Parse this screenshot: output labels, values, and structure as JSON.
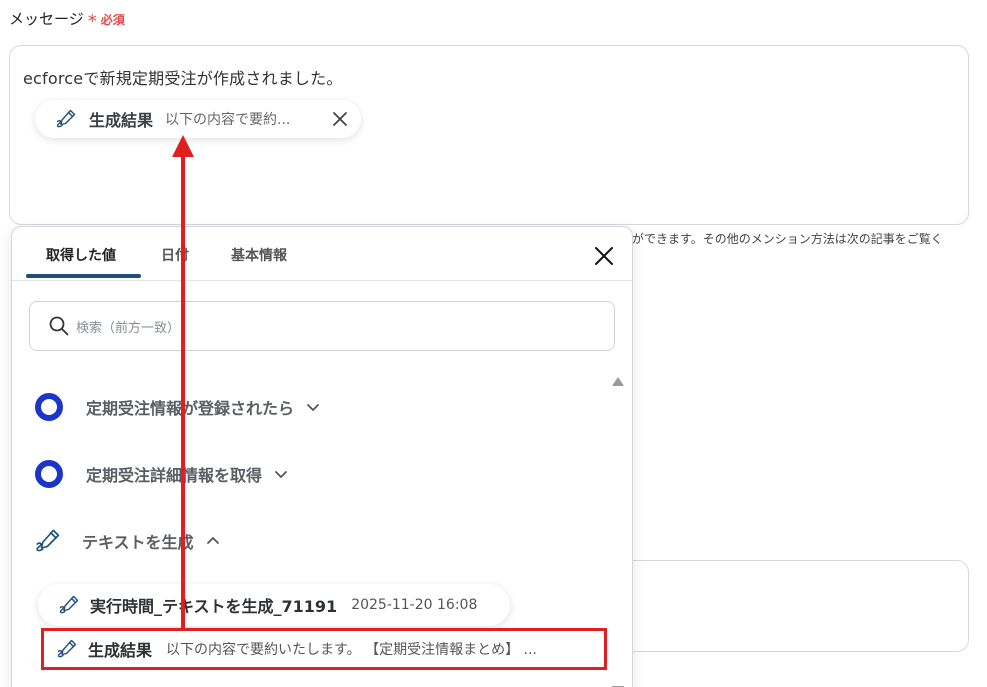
{
  "field": {
    "label": "メッセージ",
    "required_mark": "*",
    "required_text": "必須"
  },
  "message": {
    "text": "ecforceで新規定期受注が作成されました。",
    "chip": {
      "icon": "pen-icon",
      "title": "生成結果",
      "desc": "以下の内容で要約..."
    }
  },
  "help_text": "ができます。その他のメンション方法は次の記事をご覧く",
  "panel": {
    "tabs": [
      {
        "label": "取得した値",
        "active": true
      },
      {
        "label": "日付",
        "active": false
      },
      {
        "label": "基本情報",
        "active": false
      }
    ],
    "search_placeholder": "検索（前方一致）",
    "groups": [
      {
        "label": "定期受注情報が登録されたら",
        "icon": "ecforce-ring-icon",
        "expanded": false
      },
      {
        "label": "定期受注詳細情報を取得",
        "icon": "ecforce-ring-icon",
        "expanded": false
      },
      {
        "label": "テキストを生成",
        "icon": "pen-icon",
        "expanded": true
      }
    ],
    "items": [
      {
        "title": "実行時間_テキストを生成_71191",
        "desc": "2025-11-20 16:08"
      },
      {
        "title": "生成結果",
        "desc": "以下の内容で要約いたします。 【定期受注情報まとめ】 ..."
      }
    ]
  },
  "colors": {
    "accent_tab": "#1f4e79",
    "required": "#e5484d",
    "highlight": "#e02020",
    "ecforce_ring": "#1c35c9"
  }
}
